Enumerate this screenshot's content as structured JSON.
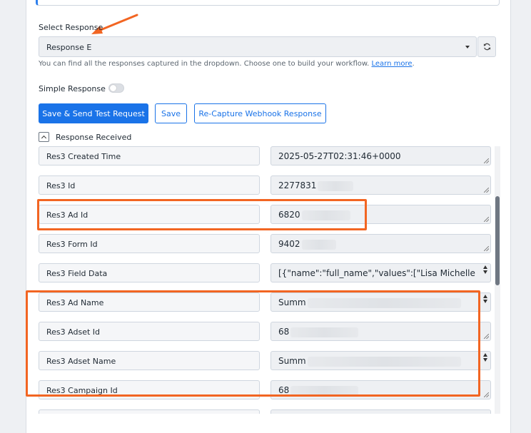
{
  "select_response": {
    "label": "Select Response",
    "value": "Response E",
    "hint": "You can find all the responses captured in the dropdown. Choose one to build your workflow.",
    "learn_more": "Learn more"
  },
  "simple_response": {
    "label": "Simple Response",
    "enabled": false
  },
  "buttons": {
    "save_send": "Save & Send Test Request",
    "save": "Save",
    "recapture": "Re-Capture Webhook Response"
  },
  "response_received": {
    "label": "Response Received"
  },
  "rows": [
    {
      "name": "Res3 Created Time",
      "value": "2025-05-27T02:31:46+0000"
    },
    {
      "name": "Res3 Id",
      "value": "2277831"
    },
    {
      "name": "Res3 Ad Id",
      "value": "6820"
    },
    {
      "name": "Res3 Form Id",
      "value": "9402"
    },
    {
      "name": "Res3 Field Data",
      "value": "[{\"name\":\"full_name\",\"values\":[\"Lisa Michelle"
    },
    {
      "name": "Res3 Ad Name",
      "value": "Summ"
    },
    {
      "name": "Res3 Adset Id",
      "value": "68"
    },
    {
      "name": "Res3 Adset Name",
      "value": "Summ"
    },
    {
      "name": "Res3 Campaign Id",
      "value": "68"
    },
    {
      "name": "",
      "value": ""
    }
  ],
  "colors": {
    "accent": "#1a73e8",
    "highlight": "#f26522"
  }
}
